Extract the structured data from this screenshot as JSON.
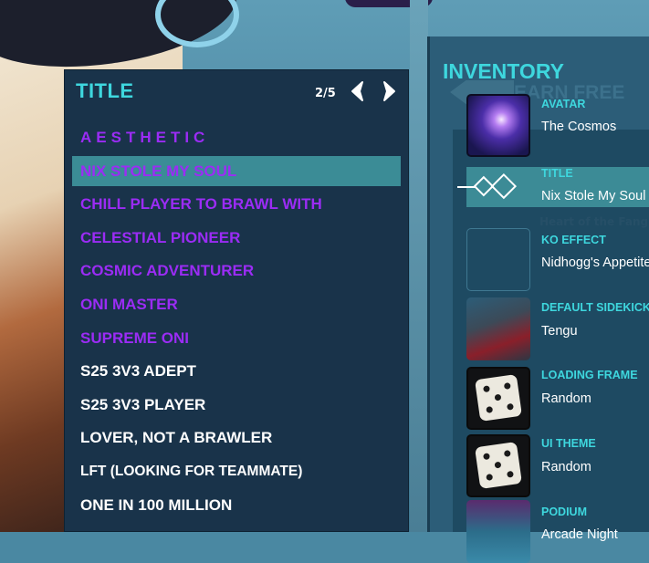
{
  "title_panel": {
    "heading": "TITLE",
    "page_indicator": "2/5",
    "prev_icon": "chevron-left-icon",
    "next_icon": "chevron-right-icon",
    "items": [
      {
        "label": "AESTHETIC",
        "color": "#9b2cf5"
      },
      {
        "label": "NIX STOLE MY SOUL",
        "color": "#9b2cf5",
        "selected": true
      },
      {
        "label": "CHILL PLAYER TO BRAWL WITH",
        "color": "#9b2cf5"
      },
      {
        "label": "CELESTIAL PIONEER",
        "color": "#9b2cf5"
      },
      {
        "label": "COSMIC ADVENTURER",
        "color": "#9b2cf5"
      },
      {
        "label": "ONI MASTER",
        "color": "#9b2cf5"
      },
      {
        "label": "SUPREME ONI",
        "color": "#9b2cf5"
      },
      {
        "label": "S25 3V3 ADEPT",
        "color": "#ffffff"
      },
      {
        "label": "S25 3V3 PLAYER",
        "color": "#ffffff"
      },
      {
        "label": "LOVER, NOT A BRAWLER",
        "color": "#ffffff"
      },
      {
        "label": "LFT (LOOKING FOR TEAMMATE)",
        "color": "#ffffff"
      },
      {
        "label": "ONE IN 100 MILLION",
        "color": "#ffffff"
      }
    ]
  },
  "inventory": {
    "heading": "INVENTORY",
    "earn_free_bg": "EARN FREE",
    "heart_bg": "Heart of the Fang",
    "slots": [
      {
        "label": "AVATAR",
        "value": "The Cosmos",
        "icon": "cosmos-avatar-icon"
      },
      {
        "label": "TITLE",
        "value": "Nix Stole My Soul",
        "icon": "title-diamond-icon",
        "selected": true
      },
      {
        "label": "KO EFFECT",
        "value": "Nidhogg's Appetite",
        "icon": "ko-effect-icon"
      },
      {
        "label": "DEFAULT SIDEKICK",
        "value": "Tengu",
        "icon": "tengu-sidekick-icon"
      },
      {
        "label": "LOADING FRAME",
        "value": "Random",
        "icon": "dice-icon"
      },
      {
        "label": "UI THEME",
        "value": "Random",
        "icon": "dice-icon"
      },
      {
        "label": "PODIUM",
        "value": "Arcade Night",
        "icon": "podium-icon"
      }
    ]
  },
  "colors": {
    "accent_cyan": "#3ed7de",
    "selected_row": "#3b8c96",
    "owned_purple": "#9b2cf5",
    "panel_bg": "#19334a"
  }
}
